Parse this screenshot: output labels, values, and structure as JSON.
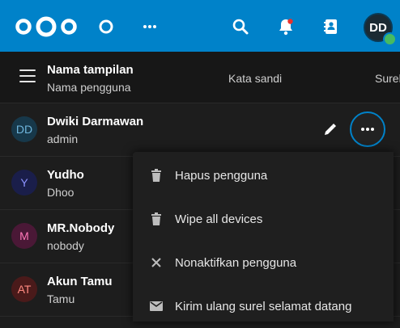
{
  "header": {
    "col_name_title": "Nama tampilan",
    "col_name_sub": "Nama pengguna",
    "col_password": "Kata sandi",
    "col_email": "Surel"
  },
  "top_avatar": {
    "initials": "DD"
  },
  "users": [
    {
      "initials": "DD",
      "name": "Dwiki Darmawan",
      "id": "admin",
      "avatar_bg": "#17384a",
      "avatar_fg": "#6fb6dd"
    },
    {
      "initials": "Y",
      "name": "Yudho",
      "id": "Dhoo",
      "avatar_bg": "#1a1e4a",
      "avatar_fg": "#8c93ff"
    },
    {
      "initials": "M",
      "name": "MR.Nobody",
      "id": "nobody",
      "avatar_bg": "#4a1836",
      "avatar_fg": "#ff77b8"
    },
    {
      "initials": "AT",
      "name": "Akun Tamu",
      "id": "Tamu",
      "avatar_bg": "#4a1a1a",
      "avatar_fg": "#ff8a80"
    }
  ],
  "menu": {
    "items": [
      {
        "label": "Hapus pengguna",
        "icon": "trash-icon"
      },
      {
        "label": "Wipe all devices",
        "icon": "trash-icon"
      },
      {
        "label": "Nonaktifkan pengguna",
        "icon": "close-icon"
      },
      {
        "label": "Kirim ulang surel selamat datang",
        "icon": "mail-icon"
      }
    ]
  },
  "colors": {
    "accent": "#0082c9",
    "background": "#1d1d1d",
    "status_online": "#46ba61"
  }
}
